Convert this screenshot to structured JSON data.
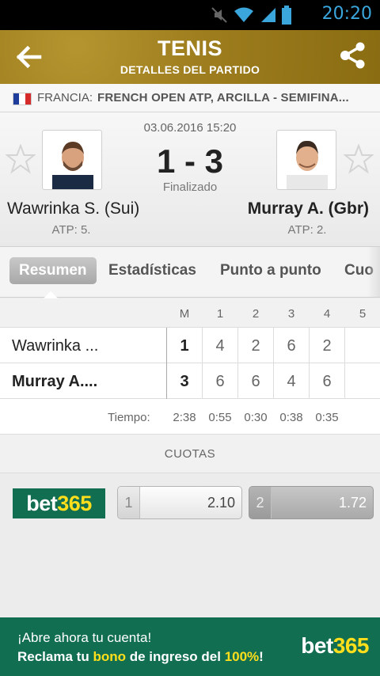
{
  "status_bar": {
    "time": "20:20"
  },
  "header": {
    "title": "TENIS",
    "subtitle": "DETALLES DEL PARTIDO"
  },
  "breadcrumb": {
    "country": "FRANCIA:",
    "competition": "FRENCH OPEN ATP, ARCILLA - SEMIFINA..."
  },
  "match": {
    "datetime": "03.06.2016 15:20",
    "score": "1 - 3",
    "status": "Finalizado",
    "home": {
      "name": "Wawrinka S. (Sui)",
      "rank": "ATP: 5."
    },
    "away": {
      "name": "Murray A. (Gbr)",
      "rank": "ATP: 2."
    }
  },
  "tabs": [
    "Resumen",
    "Estadísticas",
    "Punto a punto",
    "Cuo"
  ],
  "table": {
    "headers": [
      "M",
      "1",
      "2",
      "3",
      "4",
      "5"
    ],
    "rows": [
      {
        "name": "Wawrinka ...",
        "m": "1",
        "sets": [
          "4",
          "2",
          "6",
          "2",
          ""
        ]
      },
      {
        "name": "Murray A....",
        "m": "3",
        "sets": [
          "6",
          "6",
          "4",
          "6",
          ""
        ]
      }
    ],
    "time_label": "Tiempo:",
    "times": [
      "2:38",
      "0:55",
      "0:30",
      "0:38",
      "0:35"
    ]
  },
  "odds": {
    "section_title": "CUOTAS",
    "bookmaker": {
      "part1": "bet",
      "part2": "365"
    },
    "items": [
      {
        "label": "1",
        "value": "2.10"
      },
      {
        "label": "2",
        "value": "1.72"
      }
    ]
  },
  "promo": {
    "line1": "¡Abre ahora tu cuenta!",
    "line2_a": "Reclama tu ",
    "line2_b": "bono",
    "line2_c": " de ingreso del ",
    "line2_d": "100%",
    "line2_e": "!",
    "logo_a": "bet",
    "logo_b": "365"
  },
  "colors": {
    "header_gold": "#9e7e1e",
    "bet365_green": "#126e51",
    "bet365_yellow": "#ffdf1b",
    "statusbar_blue": "#3aa6dc"
  }
}
